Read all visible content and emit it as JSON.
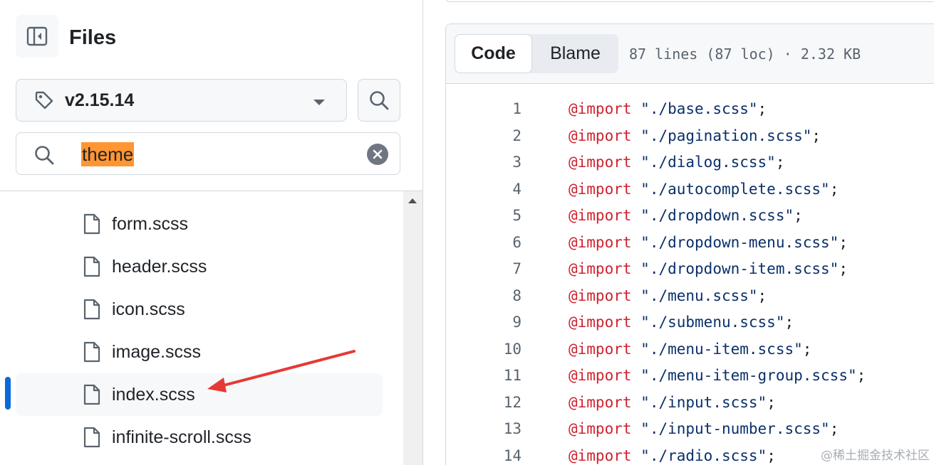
{
  "sidebar": {
    "title": "Files",
    "branch": "v2.15.14",
    "filter_value": "theme",
    "files": [
      {
        "name": "form.scss",
        "selected": false
      },
      {
        "name": "header.scss",
        "selected": false
      },
      {
        "name": "icon.scss",
        "selected": false
      },
      {
        "name": "image.scss",
        "selected": false
      },
      {
        "name": "index.scss",
        "selected": true
      },
      {
        "name": "infinite-scroll.scss",
        "selected": false
      }
    ]
  },
  "code_view": {
    "tabs": {
      "code": "Code",
      "blame": "Blame"
    },
    "meta": "87 lines (87 loc) · 2.32 KB",
    "lines": [
      {
        "n": "1",
        "kw": "@import",
        "str": "\"./base.scss\""
      },
      {
        "n": "2",
        "kw": "@import",
        "str": "\"./pagination.scss\""
      },
      {
        "n": "3",
        "kw": "@import",
        "str": "\"./dialog.scss\""
      },
      {
        "n": "4",
        "kw": "@import",
        "str": "\"./autocomplete.scss\""
      },
      {
        "n": "5",
        "kw": "@import",
        "str": "\"./dropdown.scss\""
      },
      {
        "n": "6",
        "kw": "@import",
        "str": "\"./dropdown-menu.scss\""
      },
      {
        "n": "7",
        "kw": "@import",
        "str": "\"./dropdown-item.scss\""
      },
      {
        "n": "8",
        "kw": "@import",
        "str": "\"./menu.scss\""
      },
      {
        "n": "9",
        "kw": "@import",
        "str": "\"./submenu.scss\""
      },
      {
        "n": "10",
        "kw": "@import",
        "str": "\"./menu-item.scss\""
      },
      {
        "n": "11",
        "kw": "@import",
        "str": "\"./menu-item-group.scss\""
      },
      {
        "n": "12",
        "kw": "@import",
        "str": "\"./input.scss\""
      },
      {
        "n": "13",
        "kw": "@import",
        "str": "\"./input-number.scss\""
      },
      {
        "n": "14",
        "kw": "@import",
        "str": "\"./radio.scss\""
      }
    ]
  },
  "watermark": "@稀土掘金技术社区",
  "colors": {
    "accent": "#0969da",
    "highlight": "#ff9632",
    "annotation_arrow": "#e53935"
  }
}
